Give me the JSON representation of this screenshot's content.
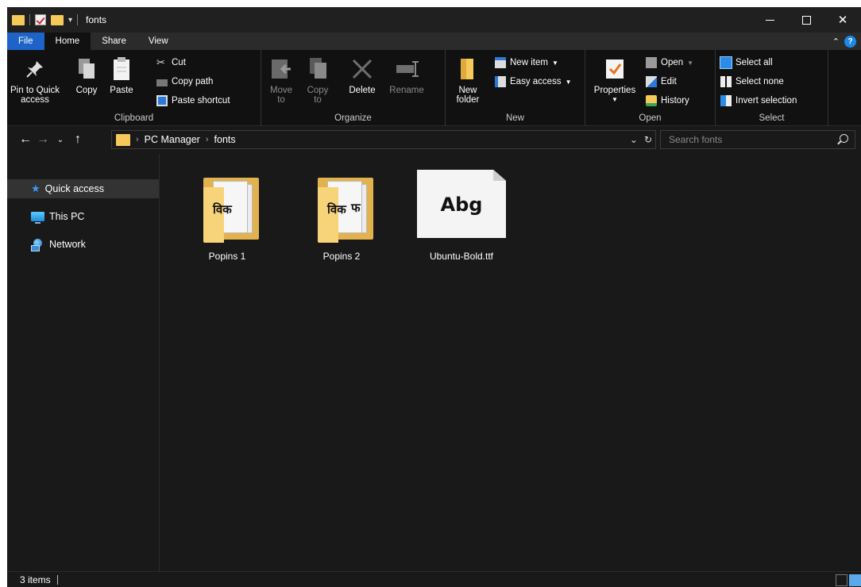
{
  "window": {
    "title": "fonts"
  },
  "tabs": [
    {
      "label": "File"
    },
    {
      "label": "Home"
    },
    {
      "label": "Share"
    },
    {
      "label": "View"
    }
  ],
  "ribbon": {
    "clipboard": {
      "label": "Clipboard",
      "pin": "Pin to Quick access",
      "copy": "Copy",
      "paste": "Paste",
      "cut": "Cut",
      "copy_path": "Copy path",
      "paste_shortcut": "Paste shortcut"
    },
    "organize": {
      "label": "Organize",
      "move_to": "Move to",
      "copy_to": "Copy to",
      "delete": "Delete",
      "rename": "Rename"
    },
    "new": {
      "label": "New",
      "new_folder": "New folder",
      "new_item": "New item",
      "easy_access": "Easy access"
    },
    "open": {
      "label": "Open",
      "properties": "Properties",
      "open": "Open",
      "edit": "Edit",
      "history": "History"
    },
    "select": {
      "label": "Select",
      "select_all": "Select all",
      "select_none": "Select none",
      "invert_selection": "Invert selection"
    }
  },
  "address": {
    "crumbs": [
      "PC Manager",
      "fonts"
    ],
    "search_placeholder": "Search fonts"
  },
  "nav_pane": [
    {
      "label": "Quick access",
      "icon": "star-icon"
    },
    {
      "label": "This PC",
      "icon": "computer-icon"
    },
    {
      "label": "Network",
      "icon": "network-icon"
    }
  ],
  "files": [
    {
      "name": "Popins 1",
      "type": "folder"
    },
    {
      "name": "Popins 2",
      "type": "folder"
    },
    {
      "name": "Ubuntu-Bold.ttf",
      "type": "font",
      "preview": "Abg"
    }
  ],
  "folder_thumb_glyphs": {
    "main": "विक",
    "extra": "फ"
  },
  "status": {
    "count": "3 items"
  },
  "colors": {
    "accent": "#1e64c8",
    "folder": "#f5c95a",
    "background": "#191919"
  }
}
